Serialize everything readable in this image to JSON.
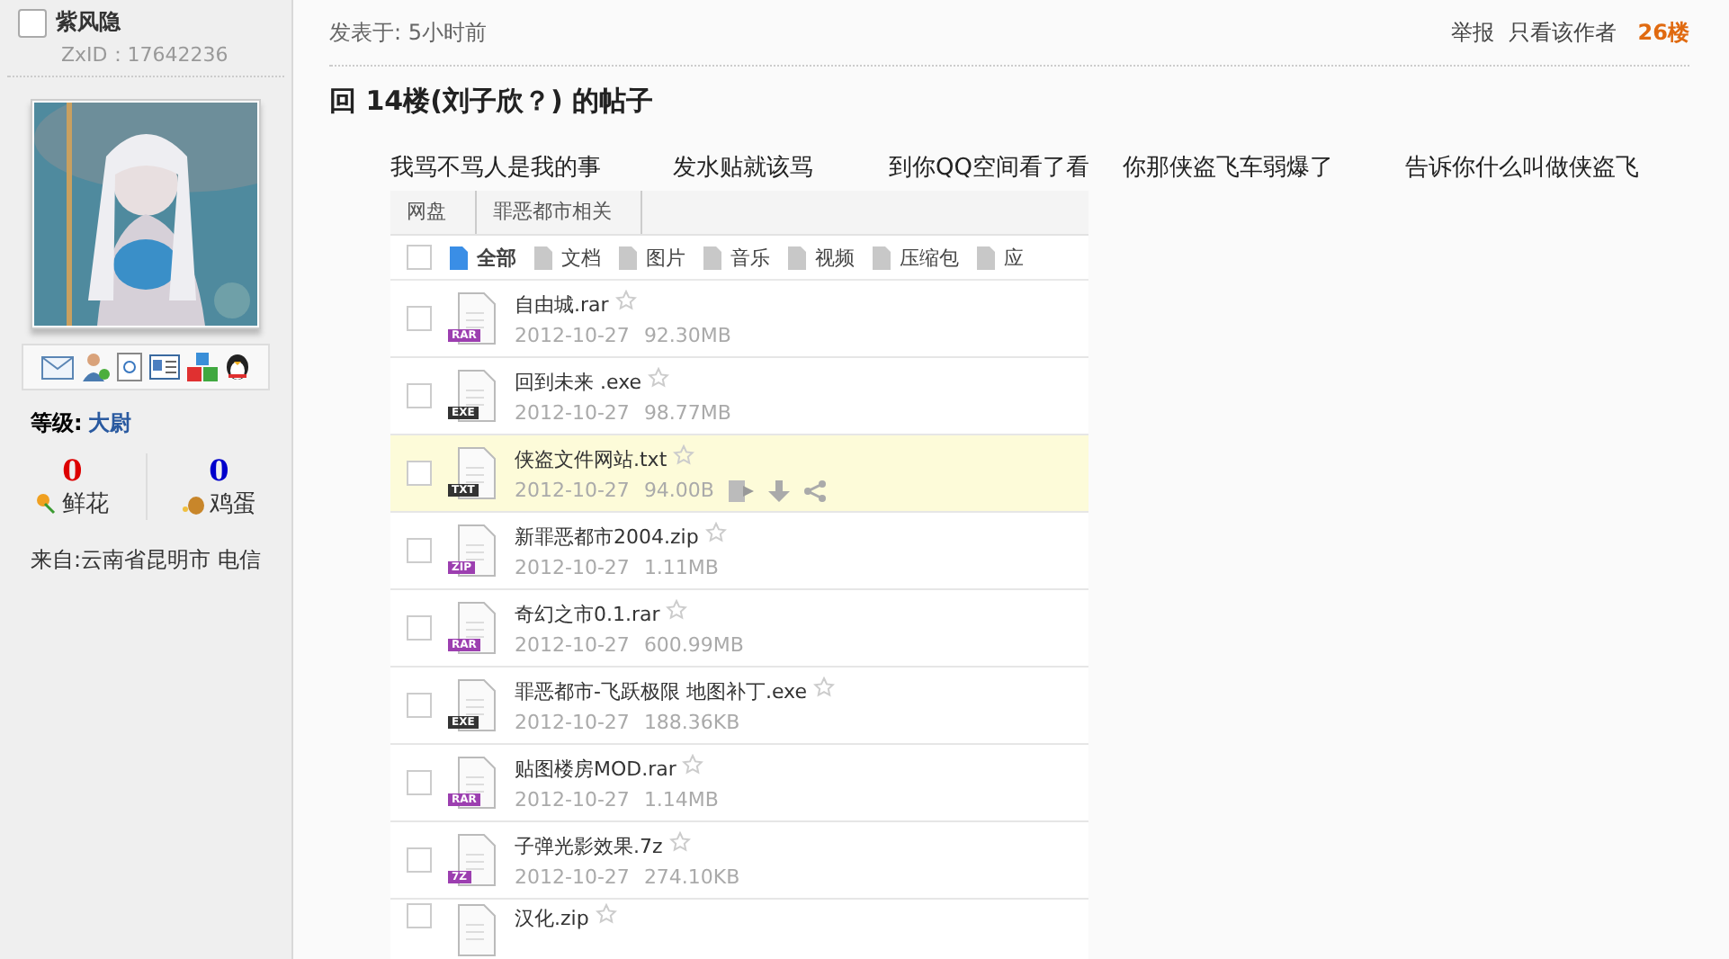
{
  "author": {
    "name": "紫风隐",
    "id": "ZxID：17642236",
    "level_label": "等级:",
    "level": "大尉",
    "stats": [
      {
        "count": "0",
        "label": "鲜花",
        "kind": "flower",
        "color": "#dd0000"
      },
      {
        "count": "0",
        "label": "鸡蛋",
        "kind": "egg",
        "color": "#0000cc"
      }
    ],
    "from": "来自:云南省昆明市 电信"
  },
  "post": {
    "time": "发表于: 5小时前",
    "actions": [
      "举报",
      "只看该作者"
    ],
    "floor": "26楼",
    "title": "回 14楼(刘子欣？) 的帖子",
    "phrases": [
      "我骂不骂人是我的事",
      "发水贴就该骂",
      "到你QQ空间看了看",
      "你那侠盗飞车弱爆了",
      "告诉你什么叫做侠盗飞"
    ]
  },
  "netdisk": {
    "breadcrumb": [
      "网盘",
      "罪恶都市相关"
    ],
    "all_checked": false,
    "filters": [
      {
        "label": "全部",
        "selected": true
      },
      {
        "label": "文档",
        "selected": false
      },
      {
        "label": "图片",
        "selected": false
      },
      {
        "label": "音乐",
        "selected": false
      },
      {
        "label": "视频",
        "selected": false
      },
      {
        "label": "压缩包",
        "selected": false
      },
      {
        "label": "应",
        "selected": false
      }
    ],
    "files": [
      {
        "name": "自由城.rar",
        "badge": "RAR",
        "color": "#9c3fb0",
        "date": "2012-10-27",
        "size": "92.30MB",
        "selected": false
      },
      {
        "name": "回到未来 .exe",
        "badge": "EXE",
        "color": "#333333",
        "date": "2012-10-27",
        "size": "98.77MB",
        "selected": false
      },
      {
        "name": "侠盗文件网站.txt",
        "badge": "TXT",
        "color": "#333333",
        "date": "2012-10-27",
        "size": "94.00B",
        "selected": true
      },
      {
        "name": "新罪恶都市2004.zip",
        "badge": "ZIP",
        "color": "#9c3fb0",
        "date": "2012-10-27",
        "size": "1.11MB",
        "selected": false
      },
      {
        "name": "奇幻之市0.1.rar",
        "badge": "RAR",
        "color": "#9c3fb0",
        "date": "2012-10-27",
        "size": "600.99MB",
        "selected": false
      },
      {
        "name": "罪恶都市-飞跃极限 地图补丁.exe",
        "badge": "EXE",
        "color": "#333333",
        "date": "2012-10-27",
        "size": "188.36KB",
        "selected": false
      },
      {
        "name": "贴图楼房MOD.rar",
        "badge": "RAR",
        "color": "#9c3fb0",
        "date": "2012-10-27",
        "size": "1.14MB",
        "selected": false
      },
      {
        "name": "子弹光影效果.7z",
        "badge": "7Z",
        "color": "#9c3fb0",
        "date": "2012-10-27",
        "size": "274.10KB",
        "selected": false
      },
      {
        "name": "汉化.zip",
        "selected": false
      }
    ]
  }
}
